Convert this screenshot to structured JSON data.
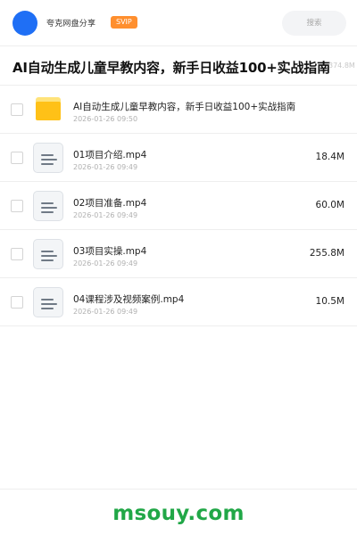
{
  "header": {
    "brand": "夸克网盘分享",
    "badge": "SVIP",
    "search_placeholder": "搜索"
  },
  "share": {
    "title": "AI自动生成儿童早教内容，新手日收益100+实战指南",
    "total_size": "374.8M"
  },
  "files": [
    {
      "type": "folder",
      "icon": "folder-icon",
      "name": "AI自动生成儿童早教内容，新手日收益100+实战指南",
      "date": "2026-01-26 09:50",
      "size": ""
    },
    {
      "type": "file",
      "icon": "video-file-icon",
      "name": "01项目介绍.mp4",
      "date": "2026-01-26 09:49",
      "size": "18.4M"
    },
    {
      "type": "file",
      "icon": "video-file-icon",
      "name": "02项目准备.mp4",
      "date": "2026-01-26 09:49",
      "size": "60.0M"
    },
    {
      "type": "file",
      "icon": "video-file-icon",
      "name": "03项目实操.mp4",
      "date": "2026-01-26 09:49",
      "size": "255.8M"
    },
    {
      "type": "file",
      "icon": "video-file-icon",
      "name": "04课程涉及视频案例.mp4",
      "date": "2026-01-26 09:49",
      "size": "10.5M"
    }
  ],
  "footer": {
    "watermark": "msouy.com"
  },
  "colors": {
    "accent_blue": "#1f6ff5",
    "badge_orange": "#ff8f2e",
    "folder_yellow": "#ffc117",
    "watermark_green": "#21a747"
  }
}
